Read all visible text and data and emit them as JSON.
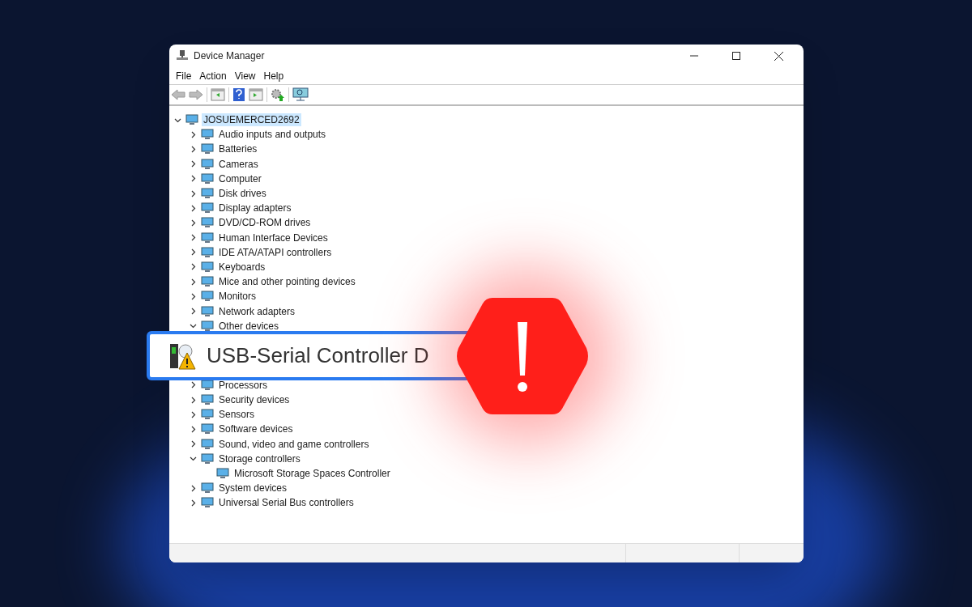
{
  "window": {
    "title": "Device Manager"
  },
  "menu": [
    "File",
    "Action",
    "View",
    "Help"
  ],
  "tree": {
    "label": "JOSUEMERCED2692",
    "selected": true,
    "expanded": true,
    "children": [
      {
        "label": "Audio inputs and outputs",
        "expanded": false
      },
      {
        "label": "Batteries",
        "expanded": false
      },
      {
        "label": "Cameras",
        "expanded": false
      },
      {
        "label": "Computer",
        "expanded": false
      },
      {
        "label": "Disk drives",
        "expanded": false
      },
      {
        "label": "Display adapters",
        "expanded": false
      },
      {
        "label": "DVD/CD-ROM drives",
        "expanded": false
      },
      {
        "label": "Human Interface Devices",
        "expanded": false
      },
      {
        "label": "IDE ATA/ATAPI controllers",
        "expanded": false
      },
      {
        "label": "Keyboards",
        "expanded": false
      },
      {
        "label": "Mice and other pointing devices",
        "expanded": false
      },
      {
        "label": "Monitors",
        "expanded": false
      },
      {
        "label": "Network adapters",
        "expanded": false
      },
      {
        "label": "Other devices",
        "expanded": true
      },
      {
        "label": "Processors",
        "expanded": false
      },
      {
        "label": "Security devices",
        "expanded": false
      },
      {
        "label": "Sensors",
        "expanded": false
      },
      {
        "label": "Software devices",
        "expanded": false
      },
      {
        "label": "Sound, video and game controllers",
        "expanded": false
      },
      {
        "label": "Storage controllers",
        "expanded": true,
        "children": [
          {
            "label": "Microsoft Storage Spaces Controller"
          }
        ]
      },
      {
        "label": "System devices",
        "expanded": false
      },
      {
        "label": "Universal Serial Bus controllers",
        "expanded": false
      }
    ]
  },
  "callout": {
    "label": "USB-Serial Controller D"
  }
}
